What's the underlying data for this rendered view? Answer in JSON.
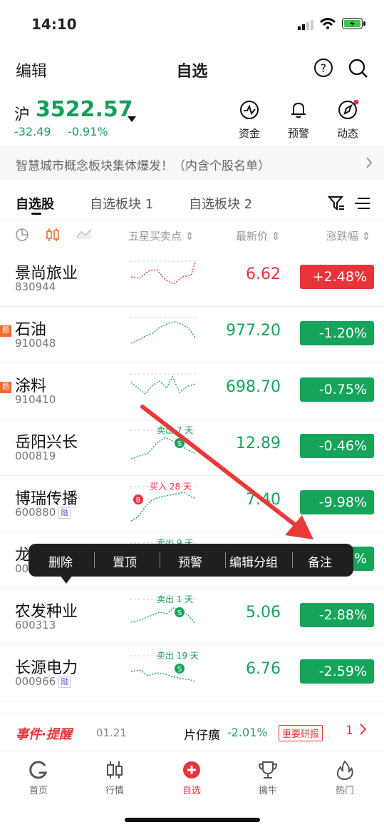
{
  "status": {
    "time": "14:10"
  },
  "nav": {
    "edit": "编辑",
    "title": "自选"
  },
  "index": {
    "name": "沪",
    "value": "3522.57",
    "change": "-32.49",
    "pct": "-0.91%"
  },
  "quick_actions": [
    "资金",
    "预警",
    "动态"
  ],
  "banner": {
    "text": "智慧城市概念板块集体爆发！（内含个股名单）"
  },
  "tabs": [
    "自选股",
    "自选板块 1",
    "自选板块 2"
  ],
  "columns": {
    "c1": "五星买卖点",
    "c2": "最新价",
    "c3": "涨跌幅"
  },
  "stocks": [
    {
      "name": "景尚旅业",
      "code": "830944",
      "price": "6.62",
      "pct": "+2.48%",
      "dir": "up",
      "tag": "",
      "rong": "",
      "signal": ""
    },
    {
      "name": "石油",
      "code": "910048",
      "price": "977.20",
      "pct": "-1.20%",
      "dir": "down",
      "tag": "题",
      "rong": "",
      "signal": ""
    },
    {
      "name": "涂料",
      "code": "910410",
      "price": "698.70",
      "pct": "-0.75%",
      "dir": "down",
      "tag": "题",
      "rong": "",
      "signal": ""
    },
    {
      "name": "岳阳兴长",
      "code": "000819",
      "price": "12.89",
      "pct": "-0.46%",
      "dir": "down",
      "tag": "",
      "rong": "",
      "signal": "卖出 7 天"
    },
    {
      "name": "博瑞传播",
      "code": "600880",
      "price": "7.40",
      "pct": "-9.98%",
      "dir": "down",
      "tag": "",
      "rong": "融",
      "signal": "买入 28 天"
    },
    {
      "name": "龙津药业",
      "code": "002750",
      "price": "",
      "pct": "-9%",
      "dir": "down",
      "tag": "",
      "rong": "",
      "signal": "卖出 9 天"
    },
    {
      "name": "农发种业",
      "code": "600313",
      "price": "5.06",
      "pct": "-2.88%",
      "dir": "down",
      "tag": "",
      "rong": "",
      "signal": "卖出 1 天"
    },
    {
      "name": "长源电力",
      "code": "000966",
      "price": "6.76",
      "pct": "-2.59%",
      "dir": "down",
      "tag": "",
      "rong": "融",
      "signal": "卖出 19 天"
    }
  ],
  "context_menu": [
    "删除",
    "置顶",
    "预警",
    "编辑分组",
    "备注"
  ],
  "event": {
    "brand": "事件·提醒",
    "date": "01.21",
    "stock": "片仔癀",
    "pct": "-2.01%",
    "badge": "重要研报",
    "count": "1"
  },
  "bottom_nav": [
    "首页",
    "行情",
    "自选",
    "擒牛",
    "热门"
  ],
  "colors": {
    "up": "#e8333b",
    "down": "#16a35a",
    "accent": "#e8333b"
  }
}
